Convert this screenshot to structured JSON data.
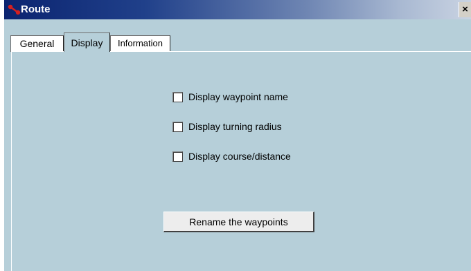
{
  "window": {
    "title": "Route",
    "close_label": "×",
    "icon": "route-icon"
  },
  "tabs": [
    {
      "label": "General"
    },
    {
      "label": "Display"
    },
    {
      "label": "Information"
    }
  ],
  "active_tab": "Display",
  "options": [
    {
      "label": "Display waypoint name",
      "checked": false
    },
    {
      "label": "Display turning radius",
      "checked": false
    },
    {
      "label": "Display course/distance",
      "checked": false
    }
  ],
  "rename_button": "Rename the waypoints",
  "colors": {
    "panel_bg": "#b6cfd9",
    "title_bar_start": "#0b2470",
    "title_text": "#ffffff",
    "icon_red": "#d42020"
  }
}
